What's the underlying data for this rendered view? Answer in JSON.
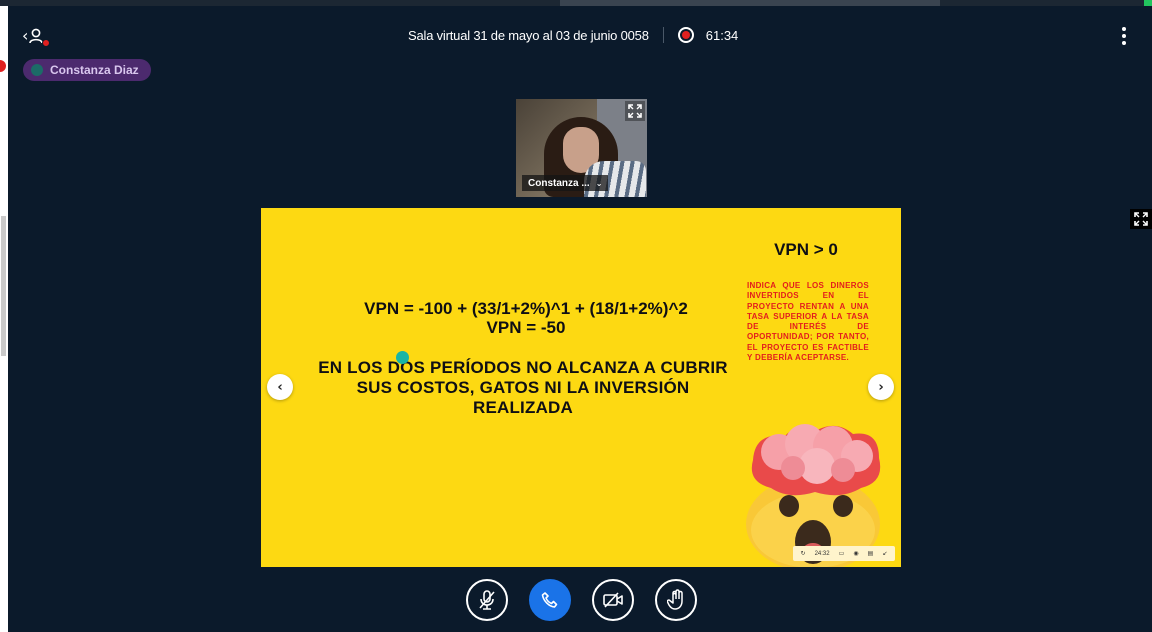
{
  "header": {
    "title": "Sala virtual 31 de mayo al 03 de junio 0058",
    "recording_time": "61:34"
  },
  "presenter": {
    "name": "Constanza Diaz"
  },
  "webcam": {
    "label": "Constanza ..."
  },
  "slide": {
    "equation_line1": "VPN = -100 + (33/1+2%)^1 + (18/1+2%)^2",
    "equation_line2": "VPN = -50",
    "conclusion": "EN LOS DOS PERÍODOS NO ALCANZA A CUBRIR SUS COSTOS, GATOS NI LA INVERSIÓN REALIZADA",
    "side_title": "VPN > 0",
    "side_text": "INDICA QUE LOS DINEROS INVERTIDOS EN EL PROYECTO RENTAN A UNA TASA SUPERIOR A LA TASA DE INTERÉS DE OPORTUNIDAD; POR TANTO, EL PROYECTO ES FACTIBLE Y DEBERÍA ACEPTARSE.",
    "toolbar_time": "24:32"
  },
  "colors": {
    "background": "#0b1a2b",
    "slide_background": "#fdd912",
    "accent_red": "#e31d1d",
    "call_button": "#1a73e8",
    "presenter_pill": "#4c2a6e"
  },
  "icons": {
    "back": "chevron-left-user-icon",
    "record": "record-icon",
    "menu": "kebab-menu-icon",
    "expand": "expand-icon",
    "prev": "chevron-left-icon",
    "next": "chevron-right-icon",
    "mic": "mic-muted-icon",
    "call": "phone-icon",
    "camera": "camera-off-icon",
    "hand": "raise-hand-icon"
  }
}
